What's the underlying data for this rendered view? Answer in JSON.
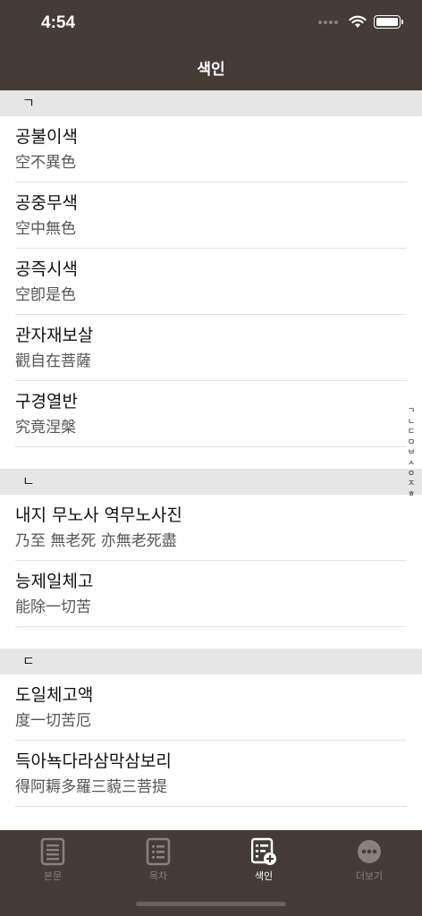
{
  "status": {
    "time": "4:54"
  },
  "nav": {
    "title": "색인"
  },
  "sections": [
    {
      "header": "ㄱ",
      "items": [
        {
          "title": "공불이색",
          "sub": "空不異色"
        },
        {
          "title": "공중무색",
          "sub": "空中無色"
        },
        {
          "title": "공즉시색",
          "sub": "空卽是色"
        },
        {
          "title": "관자재보살",
          "sub": "觀自在菩薩"
        },
        {
          "title": "구경열반",
          "sub": "究竟涅槃"
        }
      ]
    },
    {
      "header": "ㄴ",
      "items": [
        {
          "title": "내지 무노사 역무노사진",
          "sub": "乃至 無老死 亦無老死盡"
        },
        {
          "title": "능제일체고",
          "sub": "能除一切苦"
        }
      ]
    },
    {
      "header": "ㄷ",
      "items": [
        {
          "title": "도일체고액",
          "sub": "度一切苦厄"
        },
        {
          "title": "득아뇩다라삼막삼보리",
          "sub": "得阿耨多羅三藐三菩提"
        }
      ]
    }
  ],
  "index_bar": [
    "ㄱ",
    "ㄴ",
    "ㄷ",
    "ㅁ",
    "ㅂ",
    "ㅅ",
    "ㅇ",
    "ㅈ",
    "ㅎ"
  ],
  "tabs": [
    {
      "label": "본문",
      "icon": "document-icon",
      "active": false
    },
    {
      "label": "목차",
      "icon": "list-icon",
      "active": false
    },
    {
      "label": "색인",
      "icon": "index-add-icon",
      "active": true
    },
    {
      "label": "더보기",
      "icon": "more-icon",
      "active": false
    }
  ],
  "colors": {
    "header_bg": "#453c38",
    "section_bg": "#e6e6e6",
    "tab_inactive": "#8a817c",
    "tab_active": "#ffffff"
  }
}
